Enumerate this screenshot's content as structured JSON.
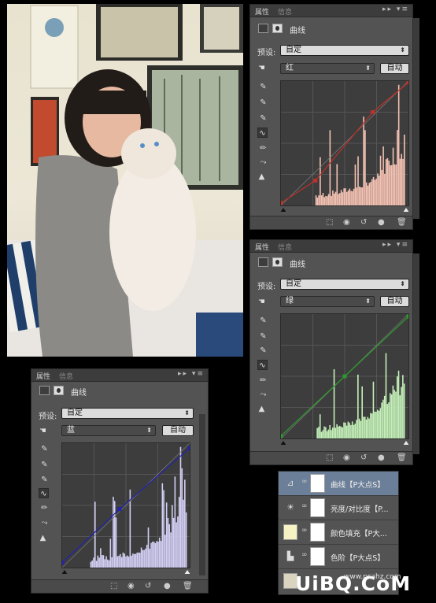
{
  "photo": {
    "subject": "girl-holding-cat"
  },
  "panels": [
    {
      "id": "red",
      "tab_active": "属性",
      "tab_inactive": "信息",
      "tab_controls": "▸▸ ▾≡",
      "title": "曲线",
      "preset_label": "预设:",
      "preset_value": "自定",
      "channel_value": "红",
      "auto_label": "自动",
      "curve_color": "#c0302a",
      "hist_color": "#f4c2b3"
    },
    {
      "id": "green",
      "tab_active": "属性",
      "tab_inactive": "信息",
      "tab_controls": "▸▸ ▾≡",
      "title": "曲线",
      "preset_label": "预设:",
      "preset_value": "自定",
      "channel_value": "绿",
      "auto_label": "自动",
      "curve_color": "#2c9a2c",
      "hist_color": "#c4f0b8"
    },
    {
      "id": "blue",
      "tab_active": "属性",
      "tab_inactive": "信息",
      "tab_controls": "▸▸ ▾≡",
      "title": "曲线",
      "preset_label": "预设:",
      "preset_value": "自定",
      "channel_value": "蓝",
      "auto_label": "自动",
      "curve_color": "#2323b0",
      "hist_color": "#d2cff4"
    }
  ],
  "layers": [
    {
      "name": "曲线【P大点S】",
      "thumb_icon": "curves-icon",
      "selected": true
    },
    {
      "name": "亮度/对比度【P...",
      "thumb_icon": "brightness-icon",
      "selected": false
    },
    {
      "name": "颜色填充【P大...",
      "thumb_icon": "color-fill-swatch",
      "selected": false
    },
    {
      "name": "色阶【P大点S】",
      "thumb_icon": "levels-icon",
      "selected": false
    },
    {
      "name": "",
      "thumb_icon": "photo-thumbnail",
      "selected": false
    }
  ],
  "watermark": {
    "main": "UiBQ.CoM",
    "sub": "www.psahz.com"
  }
}
